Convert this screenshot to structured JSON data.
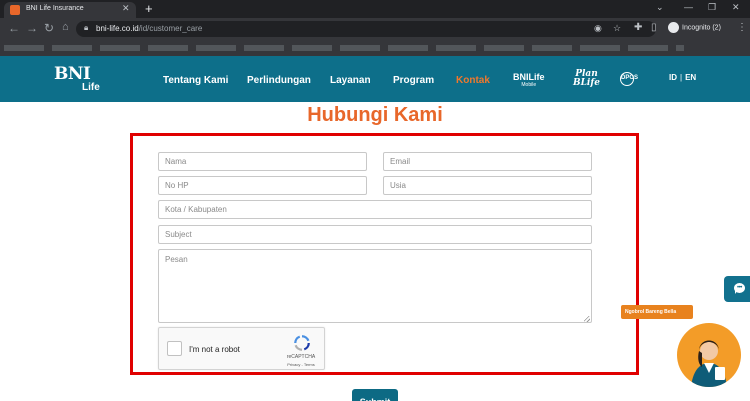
{
  "browser": {
    "tab_title": "BNI Life Insurance",
    "tab_favicon_text": "Life",
    "url_domain": "bni-life.co.id",
    "url_path": "/id/customer_care",
    "profile_label": "Incognito (2)"
  },
  "header": {
    "logo_main": "BNI",
    "logo_sub": "Life",
    "nav": [
      "Tentang Kami",
      "Perlindungan",
      "Layanan",
      "Program",
      "Kontak"
    ],
    "active_nav": "Kontak",
    "brand_bnilife": "BNILife",
    "brand_bnilife_sub": "Mobile",
    "brand_plan": "Plan",
    "brand_blife": "BLife",
    "brand_dpos": "DPOS",
    "lang_id": "ID",
    "lang_sep": "|",
    "lang_en": "EN",
    "colors": {
      "header_bg": "#0d6f8a",
      "active": "#f0782d"
    }
  },
  "page": {
    "title": "Hubungi Kami",
    "title_color": "#e8672a",
    "highlight_color": "#e00000"
  },
  "form": {
    "nama_placeholder": "Nama",
    "email_placeholder": "Email",
    "nohp_placeholder": "No HP",
    "usia_placeholder": "Usia",
    "kota_placeholder": "Kota / Kabupaten",
    "subject_placeholder": "Subject",
    "pesan_placeholder": "Pesan",
    "captcha_label": "I'm not a robot",
    "captcha_brand": "reCAPTCHA",
    "captcha_links": "Privacy - Terms",
    "submit_label": "Submit"
  },
  "assistant": {
    "tag": "Ngobrol Bareng Bella"
  }
}
